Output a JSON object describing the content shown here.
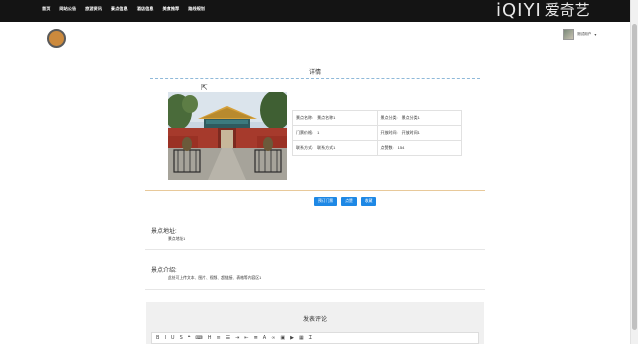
{
  "nav": {
    "items": [
      "首页",
      "网站公告",
      "旅游资讯",
      "景点信息",
      "酒店信息",
      "美食推荐",
      "路线规划"
    ]
  },
  "brand": {
    "latin": "iQIYI",
    "cjk": "爱奇艺"
  },
  "user": {
    "name": "测试用户"
  },
  "page": {
    "title": "详情"
  },
  "info": {
    "rows": [
      [
        {
          "label": "景点名称:",
          "value": "景点名称1"
        },
        {
          "label": "景点分类:",
          "value": "景点分类1"
        }
      ],
      [
        {
          "label": "门票价格:",
          "value": "1"
        },
        {
          "label": "开放时间:",
          "value": "开放时间1"
        }
      ],
      [
        {
          "label": "联系方式:",
          "value": "联系方式1"
        },
        {
          "label": "点赞数:",
          "value": "154"
        }
      ]
    ]
  },
  "buttons": {
    "book": "预订门票",
    "like": "点赞",
    "favorite": "收藏"
  },
  "address": {
    "label": "景点地址:",
    "text": "景点地址1"
  },
  "intro": {
    "label": "景点介绍:",
    "text": "此处可上传文本、图片、视频、超链接、表格等内容区1"
  },
  "comment": {
    "title": "发表评论"
  },
  "colors": {
    "topbar": "#141414",
    "button": "#1e88e5",
    "accent_line": "#e8c99a",
    "title_dash": "#8fb9d9",
    "logo": "#cc8a3d"
  },
  "icons": [
    "logo-circle-icon",
    "avatar",
    "caret-down-icon",
    "cursor-icon"
  ]
}
